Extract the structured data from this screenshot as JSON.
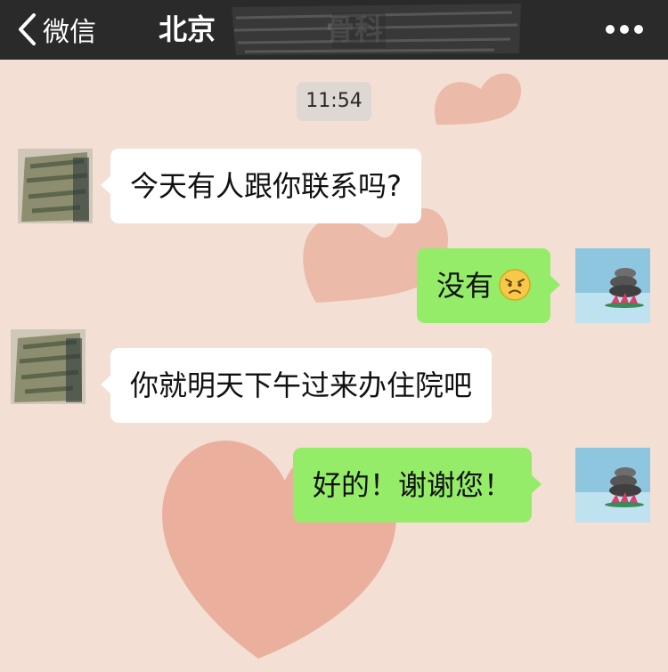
{
  "nav": {
    "back_label": "微信",
    "title": "北京",
    "title_tail": "骨科",
    "more_icon": "more-dots-icon"
  },
  "timestamp": "11:54",
  "messages": [
    {
      "sender": "contact",
      "text": "今天有人跟你联系吗?"
    },
    {
      "sender": "me",
      "text": "没有",
      "emoji": "disappointed-face-icon"
    },
    {
      "sender": "contact",
      "text": "你就明天下午过来办住院吧"
    },
    {
      "sender": "me",
      "text": "好的！谢谢您！"
    }
  ],
  "colors": {
    "navbar": "#2b2a2a",
    "incoming_bubble": "#ffffff",
    "outgoing_bubble": "#95ec69",
    "wallpaper": "#f3dfd3",
    "heart": "#e59a86"
  }
}
